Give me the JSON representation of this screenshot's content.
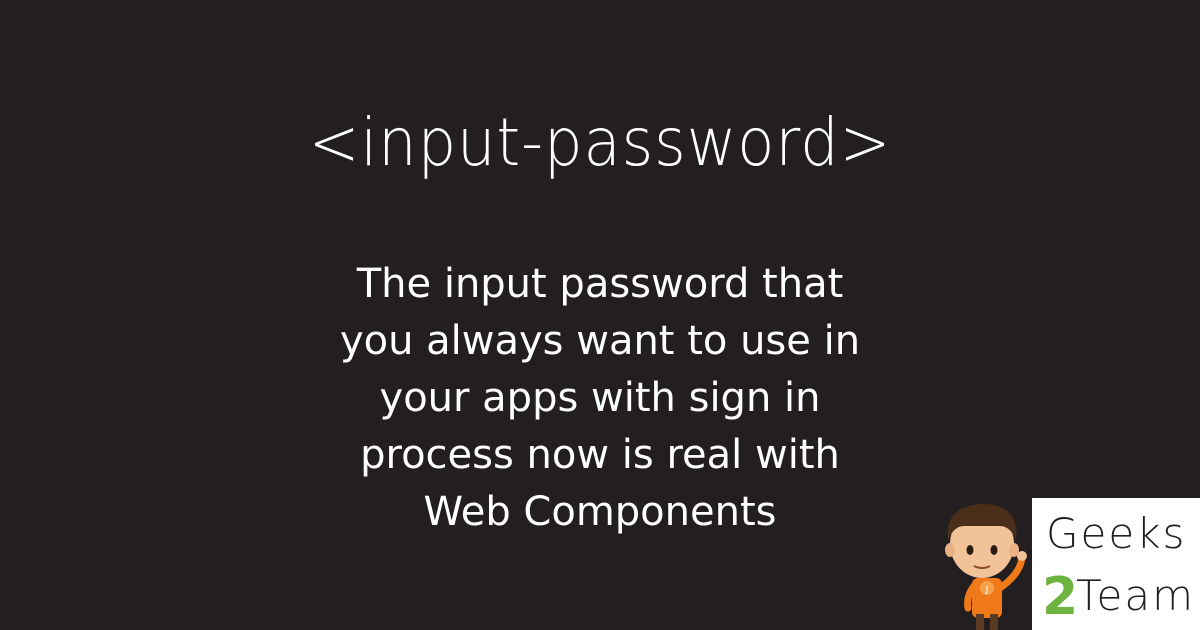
{
  "title": "<input-password>",
  "description_lines": [
    "The input password that",
    "you always want to use in",
    "your apps with sign in",
    "process now is real with",
    "Web Components"
  ],
  "mascot": {
    "badge_letter": "J",
    "icon": "boy-mascot-icon"
  },
  "logo": {
    "line1": "Geeks",
    "number": "2",
    "line2": "Team",
    "icon": "geeks2team-logo"
  },
  "colors": {
    "background": "#231f20",
    "text": "#ffffff",
    "logo_accent": "#6cb33f",
    "mascot_shirt": "#f07a1a"
  }
}
